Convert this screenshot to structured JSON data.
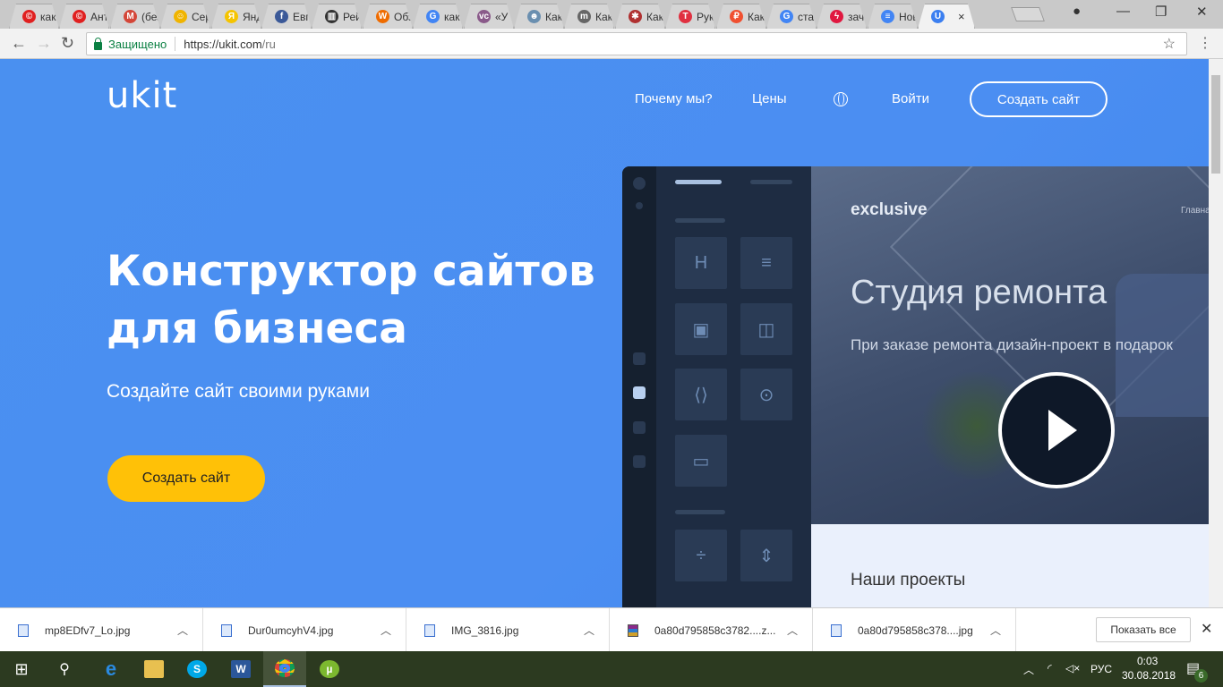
{
  "browser": {
    "tabs": [
      {
        "title": "как",
        "icon": "copyright-icon",
        "color": "#e02020",
        "glyph": "©"
      },
      {
        "title": "Ант",
        "icon": "copyright-icon",
        "color": "#e02020",
        "glyph": "©"
      },
      {
        "title": "(без",
        "icon": "gmail-icon",
        "color": "#d44638",
        "glyph": "M"
      },
      {
        "title": "Сер",
        "icon": "smiley-icon",
        "color": "#f0b400",
        "glyph": "☺"
      },
      {
        "title": "Янд",
        "icon": "yandex-icon",
        "color": "#f5c400",
        "glyph": "Я"
      },
      {
        "title": "Евге",
        "icon": "facebook-icon",
        "color": "#3b5998",
        "glyph": "f"
      },
      {
        "title": "Рей",
        "icon": "chart-icon",
        "color": "#333333",
        "glyph": "▥"
      },
      {
        "title": "Обз",
        "icon": "w-icon",
        "color": "#ef6c00",
        "glyph": "W"
      },
      {
        "title": "как",
        "icon": "google-icon",
        "color": "#4285f4",
        "glyph": "G"
      },
      {
        "title": "«У",
        "icon": "vc-icon",
        "color": "#8a5a8a",
        "glyph": "vc"
      },
      {
        "title": "Как",
        "icon": "avatar-icon",
        "color": "#6a8fb0",
        "glyph": "☻"
      },
      {
        "title": "Как",
        "icon": "m-icon",
        "color": "#666666",
        "glyph": "m"
      },
      {
        "title": "Как",
        "icon": "fish-icon",
        "color": "#b03030",
        "glyph": "✱"
      },
      {
        "title": "Рук",
        "icon": "t-icon",
        "color": "#e03040",
        "glyph": "T"
      },
      {
        "title": "Как",
        "icon": "ruble-icon",
        "color": "#f05030",
        "glyph": "₽"
      },
      {
        "title": "стат",
        "icon": "google-icon",
        "color": "#4285f4",
        "glyph": "G"
      },
      {
        "title": "зач",
        "icon": "lightning-icon",
        "color": "#e01840",
        "glyph": "ϟ"
      },
      {
        "title": "Нов",
        "icon": "docs-icon",
        "color": "#4285f4",
        "glyph": "≡"
      },
      {
        "title": "",
        "icon": "ukit-icon",
        "color": "#3b7ff0",
        "glyph": "U",
        "active": true
      }
    ],
    "close_glyph": "×",
    "secure_label": "Защищено",
    "url_host": "https://ukit.com",
    "url_path": "/ru"
  },
  "site": {
    "logo": "ukit",
    "nav": {
      "why": "Почему мы?",
      "prices": "Цены",
      "login": "Войти",
      "create": "Создать сайт"
    },
    "hero": {
      "title": "Конструктор сайтов для бизнеса",
      "subtitle": "Создайте сайт своими руками",
      "cta": "Создать сайт"
    },
    "mock": {
      "brand": "exclusive",
      "nav": "Главная",
      "title": "Студия ремонта",
      "subtitle": "При заказе ремонта дизайн-проект в подарок",
      "section": "Наши проекты",
      "heading_tile": "H"
    }
  },
  "downloads": {
    "items": [
      "mp8EDfv7_Lo.jpg",
      "Dur0umcyhV4.jpg",
      "IMG_3816.jpg",
      "0a80d795858c3782....z...",
      "0a80d795858c378....jpg"
    ],
    "show_all": "Показать все"
  },
  "taskbar": {
    "lang": "РУС",
    "time": "0:03",
    "date": "30.08.2018",
    "notifications": "6"
  }
}
